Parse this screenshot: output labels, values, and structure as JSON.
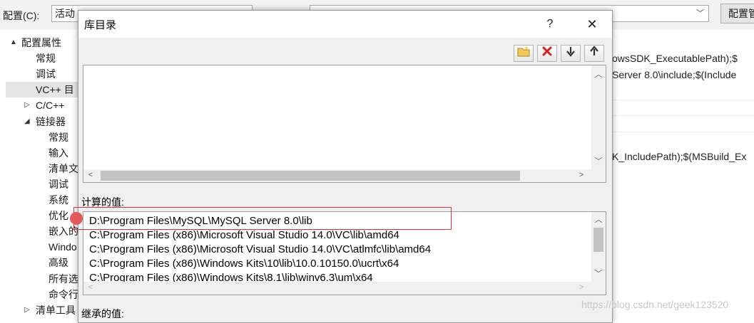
{
  "bg": {
    "config_label": "配置(C):",
    "config_value": "活动",
    "config_manager": "配置管",
    "tree": [
      {
        "label": "配置属性",
        "indent": 0,
        "twisty": "▲"
      },
      {
        "label": "常规",
        "indent": 1
      },
      {
        "label": "调试",
        "indent": 1
      },
      {
        "label": "VC++ 目",
        "indent": 1,
        "selected": true
      },
      {
        "label": "C/C++",
        "indent": 1,
        "twisty": "▷"
      },
      {
        "label": "链接器",
        "indent": 1,
        "twisty": "◢"
      },
      {
        "label": "常规",
        "indent": 2
      },
      {
        "label": "输入",
        "indent": 2
      },
      {
        "label": "清单文",
        "indent": 2
      },
      {
        "label": "调试",
        "indent": 2
      },
      {
        "label": "系统",
        "indent": 2
      },
      {
        "label": "优化",
        "indent": 2
      },
      {
        "label": "嵌入的",
        "indent": 2
      },
      {
        "label": "Windo",
        "indent": 2
      },
      {
        "label": "高级",
        "indent": 2
      },
      {
        "label": "所有选",
        "indent": 2
      },
      {
        "label": "命令行",
        "indent": 2
      },
      {
        "label": "清单工具",
        "indent": 1,
        "twisty": "▷"
      }
    ],
    "right_lines": {
      "line1": "owsSDK_ExecutablePath);$",
      "line2": "Server 8.0\\include;$(Include",
      "line3": "K_IncludePath);$(MSBuild_Ex"
    }
  },
  "dialog": {
    "title": "库目录",
    "help": "?",
    "close": "✕",
    "toolbar": {
      "new_folder": "📁",
      "delete": "✖",
      "move_down": "⬇",
      "move_up": "⬆"
    },
    "computed_label": "计算的值:",
    "computed_values": [
      "D:\\Program Files\\MySQL\\MySQL Server 8.0\\lib",
      "C:\\Program Files (x86)\\Microsoft Visual Studio 14.0\\VC\\lib\\amd64",
      "C:\\Program Files (x86)\\Microsoft Visual Studio 14.0\\VC\\atlmfc\\lib\\amd64",
      "C:\\Program Files (x86)\\Windows Kits\\10\\lib\\10.0.10150.0\\ucrt\\x64",
      "C:\\Program Files (x86)\\Windows Kits\\8.1\\lib\\winv6.3\\um\\x64"
    ],
    "inherited_label": "继承的值:"
  },
  "watermark": "https://blog.csdn.net/geek123520",
  "colors": {
    "highlight": "#e0303a",
    "dot": "#e25b5b",
    "delete_icon": "#d42020"
  }
}
